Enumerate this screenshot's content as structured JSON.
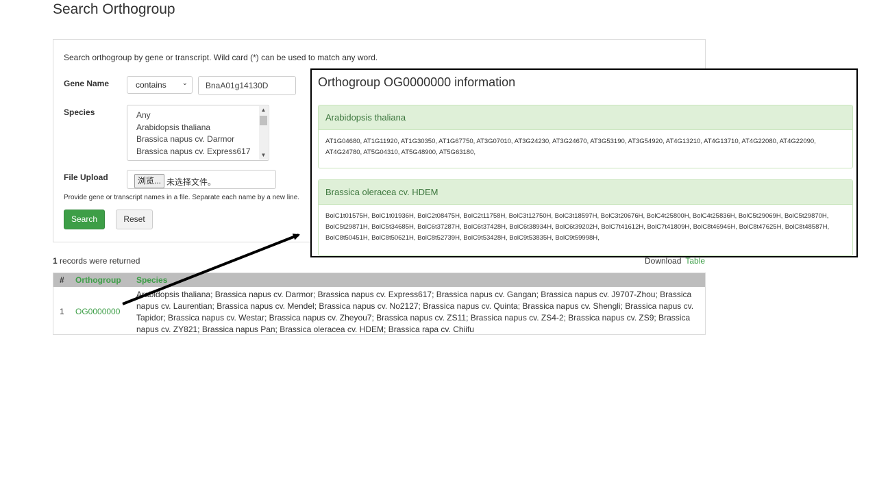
{
  "page": {
    "title": "Search Orthogroup"
  },
  "search": {
    "intro": "Search orthogroup by gene or transcript. Wild card (*) can be used to match any word.",
    "gene_name_label": "Gene Name",
    "match_mode": "contains",
    "gene_value": "BnaA01g14130D",
    "species_label": "Species",
    "species_options": [
      "Any",
      "Arabidopsis thaliana",
      "Brassica napus cv. Darmor",
      "Brassica napus cv. Express617"
    ],
    "file_upload_label": "File Upload",
    "browse_label": "浏览...",
    "no_file_label": "未选择文件。",
    "file_help": "Provide gene or transcript names in a file. Separate each name by a new line.",
    "search_button": "Search",
    "reset_button": "Reset"
  },
  "results": {
    "count": "1",
    "count_suffix": "records were returned",
    "download_label": "Download",
    "download_link": "Table",
    "columns": [
      "#",
      "Orthogroup",
      "Species"
    ],
    "rows": [
      {
        "index": "1",
        "orthogroup": "OG0000000",
        "species": "Arabidopsis thaliana; Brassica napus cv. Darmor; Brassica napus cv. Express617; Brassica napus cv. Gangan; Brassica napus cv. J9707-Zhou; Brassica napus cv. Laurentian; Brassica napus cv. Mendel; Brassica napus cv. No2127; Brassica napus cv. Quinta; Brassica napus cv. Shengli; Brassica napus cv. Tapidor; Brassica napus cv. Westar; Brassica napus cv. Zheyou7; Brassica napus cv. ZS11; Brassica napus cv. ZS4-2; Brassica napus cv. ZS9; Brassica napus cv. ZY821; Brassica napus Pan; Brassica oleracea cv. HDEM; Brassica rapa cv. Chiifu"
      }
    ]
  },
  "popup": {
    "title": "Orthogroup OG0000000 information",
    "cards": [
      {
        "species": "Arabidopsis thaliana",
        "genes": "AT1G04680, AT1G11920, AT1G30350, AT1G67750, AT3G07010, AT3G24230, AT3G24670, AT3G53190, AT3G54920, AT4G13210, AT4G13710, AT4G22080, AT4G22090, AT4G24780, AT5G04310, AT5G48900, AT5G63180,"
      },
      {
        "species": "Brassica oleracea cv. HDEM",
        "genes": "BolC1t01575H, BolC1t01936H, BolC2t08475H, BolC2t11758H, BolC3t12750H, BolC3t18597H, BolC3t20676H, BolC4t25800H, BolC4t25836H, BolC5t29069H, BolC5t29870H, BolC5t29871H, BolC5t34685H, BolC6t37287H, BolC6t37428H, BolC6t38934H, BolC6t39202H, BolC7t41612H, BolC7t41809H, BolC8t46946H, BolC8t47625H, BolC8t48587H, BolC8t50451H, BolC8t50621H, BolC8t52739H, BolC9t53428H, BolC9t53835H, BolC9t59998H,"
      }
    ]
  },
  "colors": {
    "accent_green": "#3d9e47",
    "panel_green": "#dff0d8",
    "header_gray": "#bdbdbd"
  }
}
